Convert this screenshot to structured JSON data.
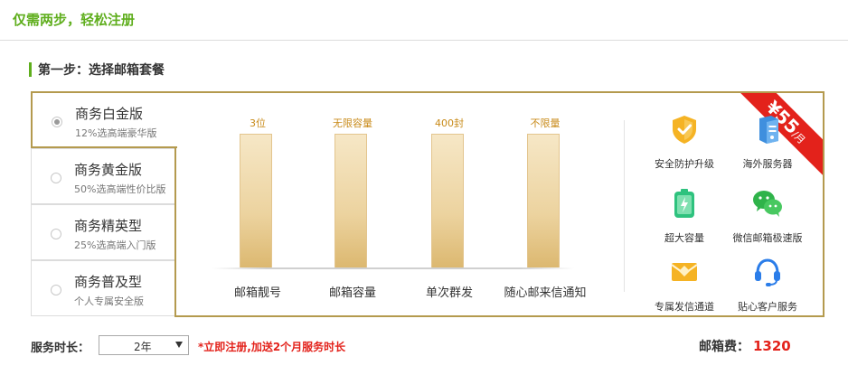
{
  "header": {
    "title": "仅需两步，轻松注册"
  },
  "step1": {
    "title": "第一步：选择邮箱套餐"
  },
  "plans": [
    {
      "name": "商务白金版",
      "desc": "12%选高端豪华版",
      "selected": true
    },
    {
      "name": "商务黄金版",
      "desc": "50%选高端性价比版",
      "selected": false
    },
    {
      "name": "商务精英型",
      "desc": "25%选高端入门版",
      "selected": false
    },
    {
      "name": "商务普及型",
      "desc": "个人专属安全版",
      "selected": false
    }
  ],
  "ribbon": {
    "price": "¥55",
    "unit": "/月"
  },
  "chart_data": {
    "type": "bar",
    "categories": [
      "邮箱靓号",
      "邮箱容量",
      "单次群发",
      "随心邮来信通知"
    ],
    "value_labels": [
      "3位",
      "无限容量",
      "400封",
      "不限量"
    ]
  },
  "features": [
    {
      "label": "安全防护升级",
      "icon": "shield-icon"
    },
    {
      "label": "海外服务器",
      "icon": "server-icon"
    },
    {
      "label": "超大容量",
      "icon": "battery-icon"
    },
    {
      "label": "微信邮箱极速版",
      "icon": "wechat-icon"
    },
    {
      "label": "专属发信通道",
      "icon": "mail-channel-icon"
    },
    {
      "label": "贴心客户服务",
      "icon": "headset-icon"
    }
  ],
  "service": {
    "label": "服务时长：",
    "selected": "2年",
    "promo": "*立即注册,加送2个月服务时长"
  },
  "fee": {
    "label": "邮箱费：",
    "amount": "1320"
  },
  "colors": {
    "accent_green": "#5fae1d",
    "gold_border": "#b49a4e",
    "red": "#e3221b",
    "value_orange": "#c88a18"
  }
}
